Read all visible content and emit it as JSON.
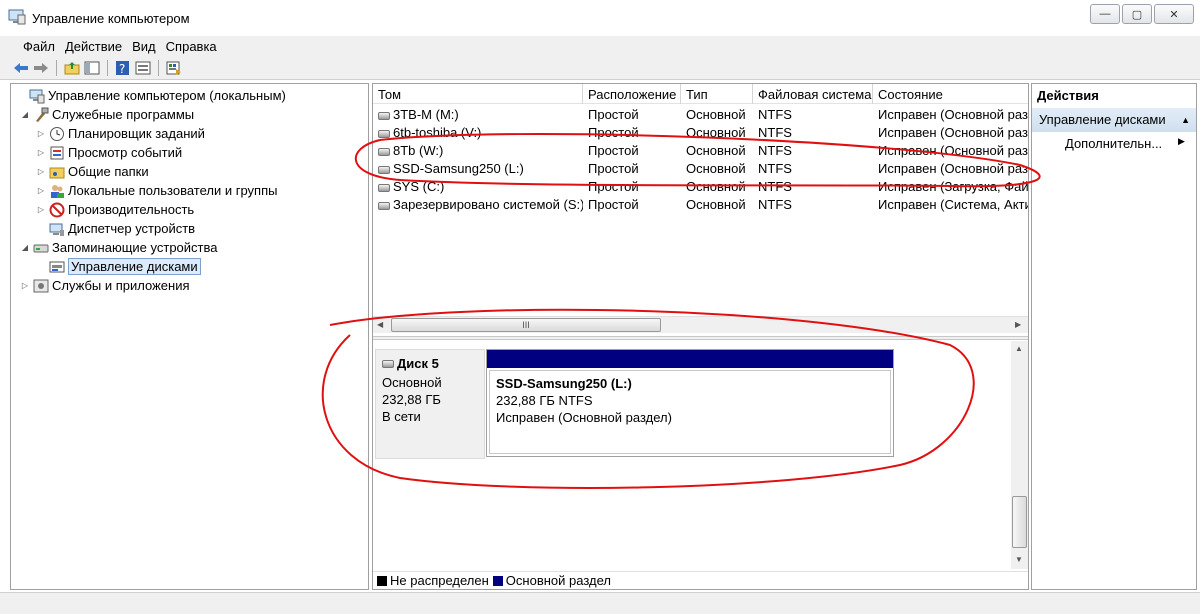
{
  "window": {
    "title": "Управление компьютером",
    "buttons": {
      "minimize": "—",
      "maximize": "▢",
      "close": "✕"
    }
  },
  "menu": [
    "Файл",
    "Действие",
    "Вид",
    "Справка"
  ],
  "toolbar_icons": [
    "back-arrow-icon",
    "forward-arrow-icon",
    "up-folder-icon",
    "show-hide-tree-icon",
    "help-icon",
    "properties-icon",
    "export-list-icon"
  ],
  "tree": [
    {
      "label": "Управление компьютером (локальным)",
      "icon": "computer-management-icon"
    },
    {
      "label": "Служебные программы",
      "icon": "tools-icon"
    },
    {
      "label": "Планировщик заданий",
      "icon": "clock-icon"
    },
    {
      "label": "Просмотр событий",
      "icon": "event-viewer-icon"
    },
    {
      "label": "Общие папки",
      "icon": "shared-folder-icon"
    },
    {
      "label": "Локальные пользователи и группы",
      "icon": "users-icon"
    },
    {
      "label": "Производительность",
      "icon": "performance-icon"
    },
    {
      "label": "Диспетчер устройств",
      "icon": "device-manager-icon"
    },
    {
      "label": "Запоминающие устройства",
      "icon": "storage-icon"
    },
    {
      "label": "Управление дисками",
      "icon": "disk-management-icon"
    },
    {
      "label": "Службы и приложения",
      "icon": "services-icon"
    }
  ],
  "volumes": {
    "headers": [
      "Том",
      "Расположение",
      "Тип",
      "Файловая система",
      "Состояние"
    ],
    "rows": [
      [
        "3TB-M (M:)",
        "Простой",
        "Основной",
        "NTFS",
        "Исправен (Основной раз"
      ],
      [
        "6tb-toshiba (V:)",
        "Простой",
        "Основной",
        "NTFS",
        "Исправен (Основной раз"
      ],
      [
        "8Tb (W:)",
        "Простой",
        "Основной",
        "NTFS",
        "Исправен (Основной раз"
      ],
      [
        "SSD-Samsung250 (L:)",
        "Простой",
        "Основной",
        "NTFS",
        "Исправен (Основной раз"
      ],
      [
        "SYS (C:)",
        "Простой",
        "Основной",
        "NTFS",
        "Исправен (Загрузка, Фай"
      ],
      [
        "Зарезервировано системой (S:)",
        "Простой",
        "Основной",
        "NTFS",
        "Исправен (Система, Акти"
      ]
    ]
  },
  "hscroll_thumb": "III",
  "disk": {
    "name": "Диск 5",
    "type": "Основной",
    "size": "232,88 ГБ",
    "status": "В сети",
    "partition": {
      "name": "SSD-Samsung250  (L:)",
      "size_fs": "232,88 ГБ NTFS",
      "state": "Исправен (Основной раздел)",
      "color": "#000080"
    }
  },
  "legend": [
    {
      "label": "Не распределен",
      "color": "#000000"
    },
    {
      "label": "Основной раздел",
      "color": "#000080"
    }
  ],
  "actions": {
    "title": "Действия",
    "section": "Управление дисками",
    "more": "Дополнительн..."
  },
  "annotation_color": "#e01010"
}
